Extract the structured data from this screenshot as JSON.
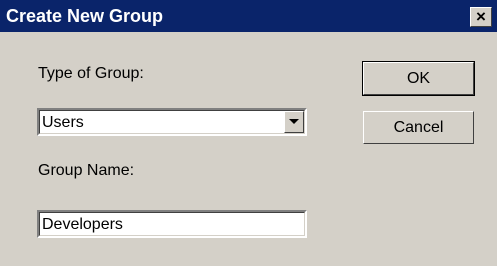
{
  "window": {
    "title": "Create New Group",
    "close_symbol": "×"
  },
  "form": {
    "type_label": "Type of Group:",
    "type_value": "Users",
    "name_label": "Group Name:",
    "name_value": "Developers"
  },
  "buttons": {
    "ok_label": "OK",
    "cancel_label": "Cancel"
  },
  "icons": {
    "close": "close-icon",
    "dropdown": "chevron-down-icon"
  },
  "colors": {
    "titlebar": "#0a246a",
    "dialog_bg": "#d4d0c8"
  }
}
